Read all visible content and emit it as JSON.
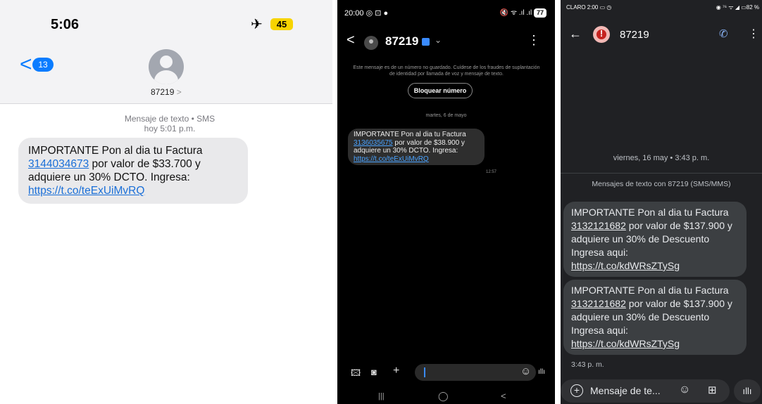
{
  "ios": {
    "status_time": "5:06",
    "airplane_icon": "✈",
    "battery": "45",
    "back_glyph": "<",
    "back_badge": "13",
    "contact_name": "87219",
    "contact_chevron": ">",
    "meta_line1": "Mensaje de texto • SMS",
    "meta_line2": "hoy 5:01 p.m.",
    "message": {
      "pre": "IMPORTANTE Pon al dia tu Factura ",
      "number": "3144034673",
      "mid": " por valor de $33.700 y adquiere un 30% DCTO. Ingresa: ",
      "url": "https://t.co/teExUiMvRQ"
    }
  },
  "samsung": {
    "status_time": "20:00",
    "status_icons_left": "◎ ⊡ ●",
    "status_icons_right": "🔇 ᯤ .ıl .ıl",
    "battery": "77",
    "contact_name": "87219",
    "warning": "Este mensaje es de un número no guardado. Cuídese de los fraudes de suplantación de identidad por llamada de voz y mensaje de texto.",
    "block_label": "Bloquear número",
    "date": "martes, 6 de mayo",
    "message": {
      "pre": "IMPORTANTE Pon al dia tu Factura ",
      "number": "3136035675",
      "mid": " por valor de $38.900 y adquiere un 30% DCTO. Ingresa: ",
      "url": "https://t.co/teExUiMvRQ"
    },
    "time": "12:57",
    "composer_icons": {
      "gallery": "🖾",
      "camera": "◙",
      "plus": "+",
      "emoji": "☺",
      "voice": "ıllı"
    },
    "nav": {
      "recents": "|||",
      "home": "◯",
      "back": "<"
    }
  },
  "google": {
    "status_left": "CLARO 2:00 ▭ ◷",
    "status_right": "◉ ⁷⁶ ᯤ ◢ ▭82 %",
    "contact_name": "87219",
    "date": "viernes, 16 may • 3:43 p. m.",
    "subheader": "Mensajes de texto con 87219 (SMS/MMS)",
    "messages": [
      {
        "pre": "IMPORTANTE Pon al dia tu Factura ",
        "number": "3132121682",
        "mid": " por valor de $137.900 y adquiere un 30% de Descuento Ingresa aqui: ",
        "url": "https://t.co/kdWRsZTySg"
      },
      {
        "pre": "IMPORTANTE Pon al dia tu Factura ",
        "number": "3132121682",
        "mid": " por valor de $137.900 y adquiere un 30% de Descuento Ingresa aqui: ",
        "url": "https://t.co/kdWRsZTySg"
      }
    ],
    "time": "3:43 p. m.",
    "composer_placeholder": "Mensaje de te...",
    "composer_icons": {
      "add": "+",
      "emoji": "☺",
      "attach": "⊞",
      "mic": "ıllı"
    }
  }
}
